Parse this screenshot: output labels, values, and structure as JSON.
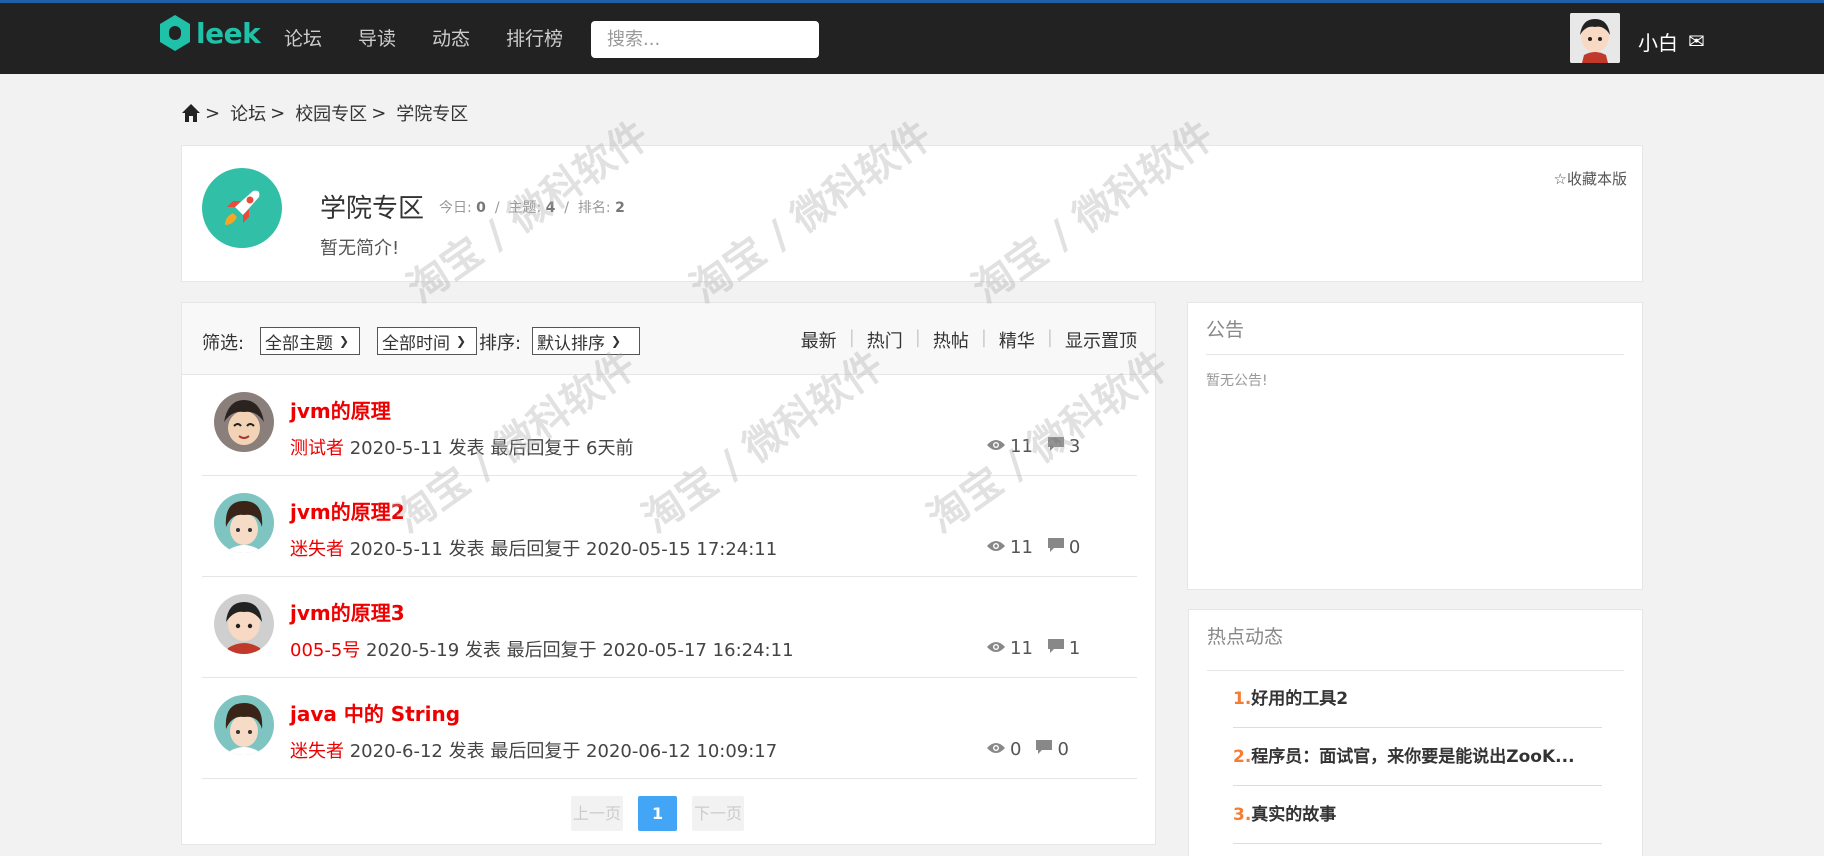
{
  "header": {
    "logo_text": "leek",
    "nav": [
      "论坛",
      "导读",
      "动态",
      "排行榜"
    ],
    "search_placeholder": "搜索...",
    "username": "小白",
    "mail_glyph": "✉"
  },
  "breadcrumb": {
    "items": [
      "论坛",
      "校园专区",
      "学院专区"
    ],
    "separator": ">"
  },
  "board": {
    "title": "学院专区",
    "stats": {
      "today_label": "今日:",
      "today": "0",
      "topics_label": "主题:",
      "topics": "4",
      "rank_label": "排名:",
      "rank": "2",
      "divider": "/"
    },
    "description": "暂无简介!",
    "favorite": "☆收藏本版"
  },
  "filter": {
    "label": "筛选:",
    "topic_select": "全部主题",
    "time_select": "全部时间",
    "sort_label": "排序:",
    "sort_select": "默认排序",
    "sort_links": [
      "最新",
      "热门",
      "热帖",
      "精华",
      "显示置顶"
    ]
  },
  "threads": [
    {
      "title": "jvm的原理",
      "author": "测试者",
      "meta": " 2020-5-11 发表 最后回复于 6天前",
      "views": "11",
      "replies": "3"
    },
    {
      "title": "jvm的原理2",
      "author": "迷失者",
      "meta": " 2020-5-11 发表 最后回复于 2020-05-15 17:24:11",
      "views": "11",
      "replies": "0"
    },
    {
      "title": "jvm的原理3",
      "author": "005-5号",
      "meta": " 2020-5-19 发表 最后回复于 2020-05-17 16:24:11",
      "views": "11",
      "replies": "1"
    },
    {
      "title": "java 中的 String",
      "author": "迷失者",
      "meta": " 2020-6-12 发表 最后回复于 2020-06-12 10:09:17",
      "views": "0",
      "replies": "0"
    }
  ],
  "pager": {
    "prev": "上一页",
    "current": "1",
    "next": "下一页"
  },
  "notice": {
    "title": "公告",
    "text": "暂无公告!"
  },
  "hot": {
    "title": "热点动态",
    "items": [
      {
        "num": "1.",
        "text": "好用的工具2"
      },
      {
        "num": "2.",
        "text": "程序员：面试官，来你要是能说出ZooK..."
      },
      {
        "num": "3.",
        "text": "真实的故事"
      }
    ]
  },
  "watermark": "淘宝 / 微科软件",
  "colors": {
    "accent_red": "#ee0000",
    "teal": "#32bfa7",
    "pager_blue": "#42a5f5",
    "hot_num": "#f57c31"
  }
}
